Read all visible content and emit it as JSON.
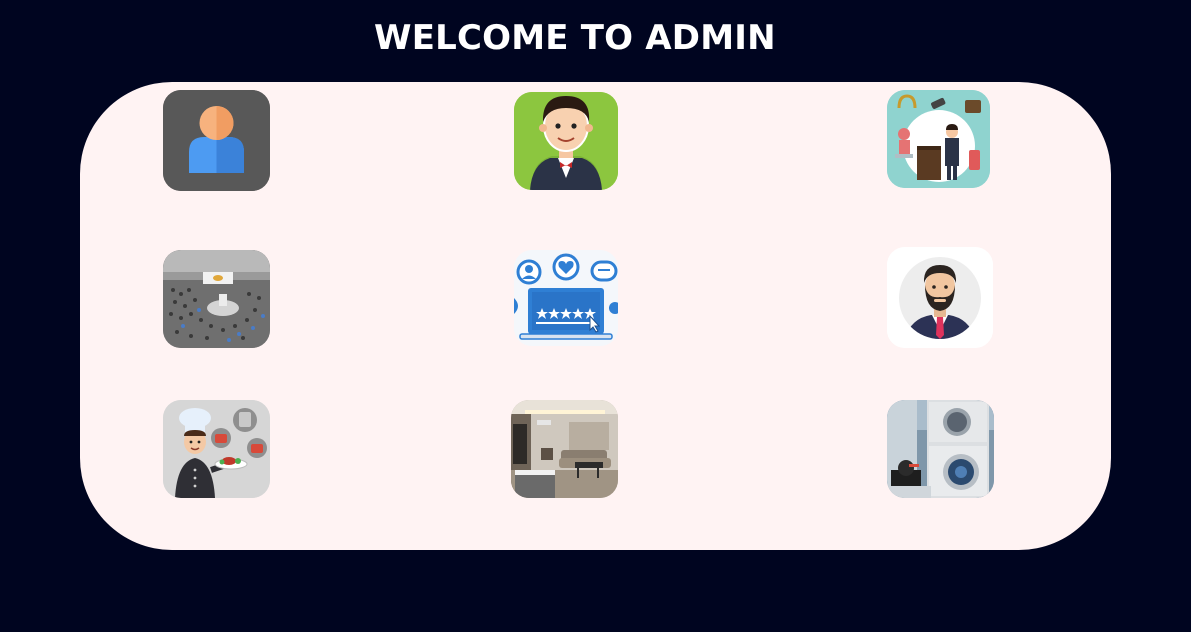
{
  "header": {
    "title": "WELCOME TO ADMIN"
  },
  "tiles": [
    {
      "name": "users-tile",
      "icon": "user-icon"
    },
    {
      "name": "staff-tile",
      "icon": "waiter-icon"
    },
    {
      "name": "reception-tile",
      "icon": "receptionist-icon"
    },
    {
      "name": "events-tile",
      "icon": "conference-hall-icon"
    },
    {
      "name": "reviews-tile",
      "icon": "rating-laptop-icon"
    },
    {
      "name": "manager-tile",
      "icon": "bearded-man-avatar-icon"
    },
    {
      "name": "restaurant-tile",
      "icon": "chef-icon"
    },
    {
      "name": "rooms-tile",
      "icon": "hotel-room-icon"
    },
    {
      "name": "laundry-tile",
      "icon": "washing-machine-icon"
    }
  ],
  "colors": {
    "background": "#000520",
    "panel": "#fff3f3",
    "title": "#ffffff"
  }
}
